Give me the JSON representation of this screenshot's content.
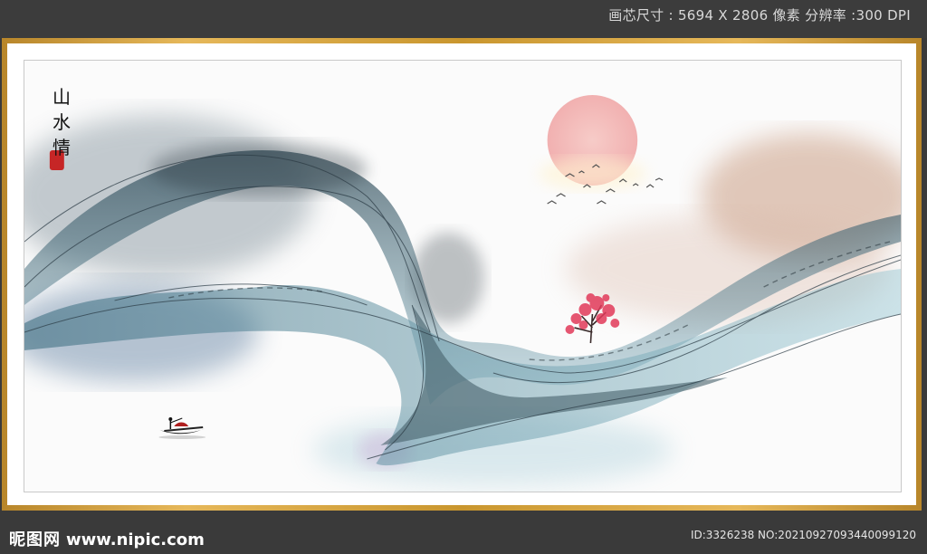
{
  "top_info": "画芯尺寸 : 5694 X 2806 像素  分辨率 :300 DPI",
  "calligraphy": [
    "山",
    "水",
    "情"
  ],
  "footer": {
    "logo_cn": "昵图网",
    "logo_url": "www.nipic.com",
    "id_text": "ID:3326238 NO:20210927093440099120"
  },
  "colors": {
    "frame_gold": "#d4a443",
    "sun": "#f0a8a8",
    "seal": "#c62626",
    "blossom": "#e23a5a"
  }
}
